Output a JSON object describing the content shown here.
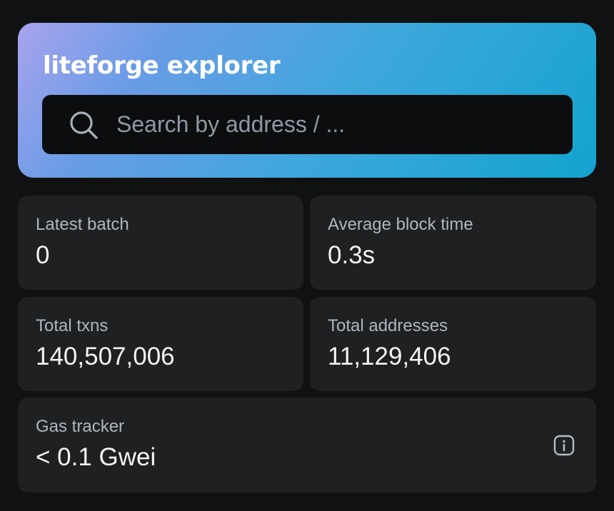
{
  "hero": {
    "title": "liteforge explorer",
    "search": {
      "placeholder": "Search by address / ...",
      "value": "",
      "icon": "search-icon"
    }
  },
  "stats": [
    {
      "label": "Latest batch",
      "value": "0"
    },
    {
      "label": "Average block time",
      "value": "0.3s"
    },
    {
      "label": "Total txns",
      "value": "140,507,006"
    },
    {
      "label": "Total addresses",
      "value": "11,129,406"
    },
    {
      "label": "Gas tracker",
      "value": "< 0.1 Gwei",
      "icon": "info-icon"
    }
  ],
  "colors": {
    "background": "#101112",
    "card": "#1f2022",
    "gradient_start": "#a9a3ee",
    "gradient_end": "#13a3cf",
    "search_bg": "#0c0d0e"
  }
}
